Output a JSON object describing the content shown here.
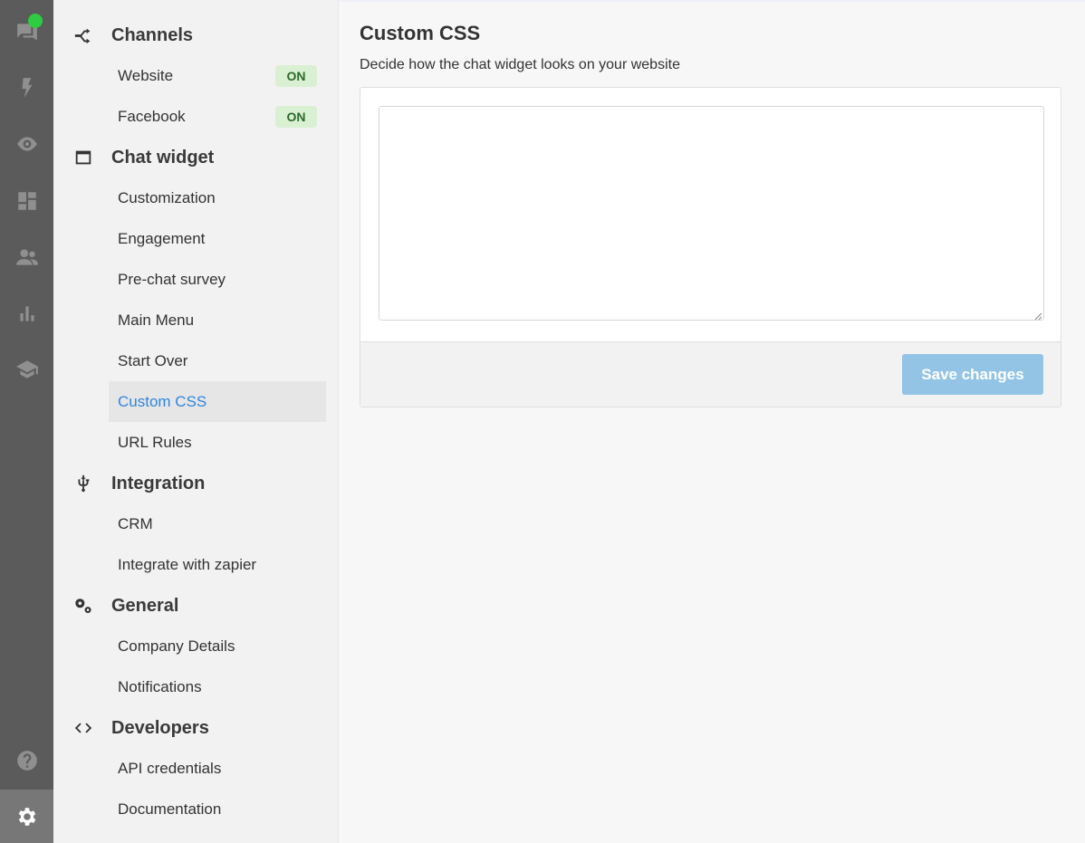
{
  "rail": {
    "icons": [
      "chat-icon",
      "bolt-icon",
      "eye-icon",
      "dashboard-icon",
      "people-icon",
      "bar-chart-icon",
      "graduation-cap-icon",
      "help-icon",
      "settings-icon"
    ]
  },
  "nav": {
    "channels": {
      "title": "Channels",
      "items": [
        {
          "label": "Website",
          "badge": "ON"
        },
        {
          "label": "Facebook",
          "badge": "ON"
        }
      ]
    },
    "chat_widget": {
      "title": "Chat widget",
      "items": [
        "Customization",
        "Engagement",
        "Pre-chat survey",
        "Main Menu",
        "Start Over",
        "Custom CSS",
        "URL Rules"
      ]
    },
    "integration": {
      "title": "Integration",
      "items": [
        "CRM",
        "Integrate with zapier"
      ]
    },
    "general": {
      "title": "General",
      "items": [
        "Company Details",
        "Notifications"
      ]
    },
    "developers": {
      "title": "Developers",
      "items": [
        "API credentials",
        "Documentation"
      ]
    }
  },
  "main": {
    "title": "Custom CSS",
    "subtitle": "Decide how the chat widget looks on your website",
    "css_value": "",
    "save_label": "Save changes"
  },
  "colors": {
    "accent": "#2e86de",
    "button": "#93c4e6",
    "badge_bg": "#d9f0d3",
    "online": "#2ecc40"
  }
}
